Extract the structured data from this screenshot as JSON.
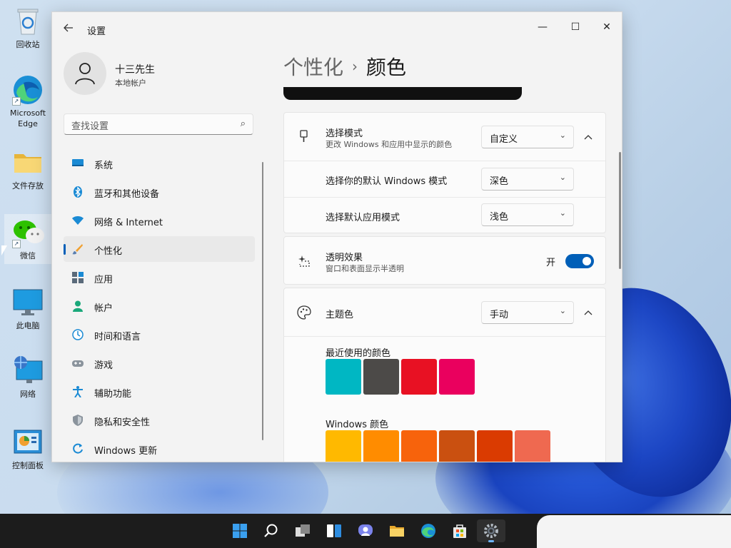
{
  "desktop": {
    "icons": [
      {
        "label": "回收站"
      },
      {
        "label": "Microsoft\nEdge"
      },
      {
        "label": "文件存放"
      },
      {
        "label": "微信"
      },
      {
        "label": "此电脑"
      },
      {
        "label": "网络"
      },
      {
        "label": "控制面板"
      }
    ]
  },
  "window": {
    "title": "设置",
    "controls": {
      "minimize": "—",
      "maximize": "☐",
      "close": "✕"
    }
  },
  "profile": {
    "name": "十三先生",
    "account_type": "本地帐户"
  },
  "search": {
    "placeholder": "查找设置"
  },
  "nav": {
    "items": [
      {
        "label": "系统",
        "icon": "monitor-icon"
      },
      {
        "label": "蓝牙和其他设备",
        "icon": "bluetooth-icon"
      },
      {
        "label": "网络 & Internet",
        "icon": "wifi-icon"
      },
      {
        "label": "个性化",
        "icon": "brush-icon",
        "active": true
      },
      {
        "label": "应用",
        "icon": "apps-icon"
      },
      {
        "label": "帐户",
        "icon": "person-icon"
      },
      {
        "label": "时间和语言",
        "icon": "clock-globe-icon"
      },
      {
        "label": "游戏",
        "icon": "gamepad-icon"
      },
      {
        "label": "辅助功能",
        "icon": "accessibility-icon"
      },
      {
        "label": "隐私和安全性",
        "icon": "shield-icon"
      },
      {
        "label": "Windows 更新",
        "icon": "update-icon"
      }
    ]
  },
  "breadcrumb": {
    "parent": "个性化",
    "separator": "›",
    "current": "颜色"
  },
  "mode_card": {
    "title": "选择模式",
    "subtitle": "更改 Windows 和应用中显示的颜色",
    "value": "自定义",
    "windows_mode_label": "选择你的默认 Windows 模式",
    "windows_mode_value": "深色",
    "app_mode_label": "选择默认应用模式",
    "app_mode_value": "浅色"
  },
  "transparency": {
    "title": "透明效果",
    "subtitle": "窗口和表面显示半透明",
    "state": "开",
    "on": true
  },
  "accent": {
    "title": "主题色",
    "value": "手动",
    "recent_label": "最近使用的颜色",
    "recent_colors": [
      "#00b7c3",
      "#4c4a48",
      "#e81123",
      "#ea005e"
    ],
    "windows_label": "Windows 颜色",
    "windows_colors": [
      "#ffb900",
      "#ff8c00",
      "#f7630c",
      "#ca5010",
      "#da3b01",
      "#ef6950"
    ]
  },
  "taskbar": {
    "apps": [
      "start-icon",
      "search-icon",
      "task-view-icon",
      "widgets-icon",
      "teams-chat-icon",
      "file-explorer-icon",
      "edge-icon",
      "store-icon",
      "settings-icon"
    ]
  }
}
